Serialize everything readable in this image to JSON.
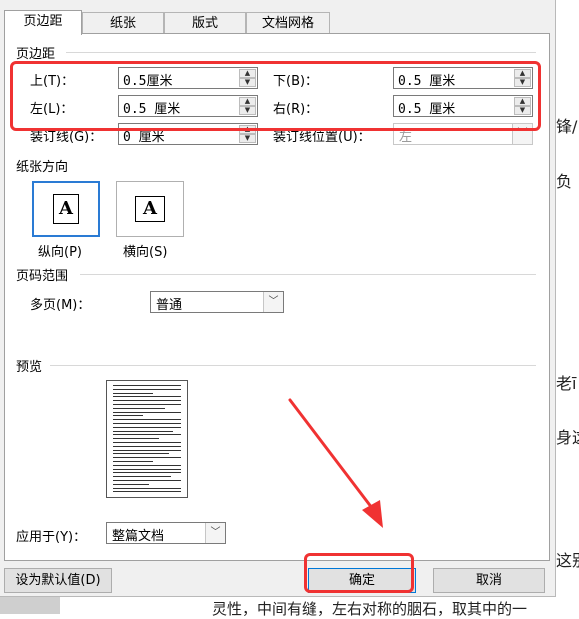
{
  "tabs": [
    "页边距",
    "纸张",
    "版式",
    "文档网格"
  ],
  "margins": {
    "title": "页边距",
    "top": {
      "label": "上(T)：",
      "value": "0.5厘米"
    },
    "bottom": {
      "label": "下(B)：",
      "value": "0.5 厘米"
    },
    "left": {
      "label": "左(L)：",
      "value": "0.5 厘米"
    },
    "right": {
      "label": "右(R)：",
      "value": "0.5 厘米"
    },
    "gutter": {
      "label": "装订线(G)：",
      "value": "0 厘米"
    },
    "gutter_pos": {
      "label": "装订线位置(U)：",
      "value": "左"
    }
  },
  "orientation": {
    "title": "纸张方向",
    "portrait": {
      "label": "纵向(P)",
      "glyph": "A"
    },
    "landscape": {
      "label": "横向(S)",
      "glyph": "A"
    }
  },
  "pages": {
    "title": "页码范围",
    "multi_label": "多页(M)：",
    "multi_value": "普通"
  },
  "preview": {
    "title": "预览"
  },
  "apply": {
    "label": "应用于(Y)：",
    "value": "整篇文档"
  },
  "buttons": {
    "default": "设为默认值(D)",
    "ok": "确定",
    "cancel": "取消"
  },
  "background_text": [
    "锋/",
    "负",
    "老ī",
    "身这",
    "这别",
    "灵性，中间有缝，左右对称的胭石，取其中的一"
  ],
  "colors": {
    "highlight": "#f03232",
    "accent": "#2a7bd4"
  },
  "icons": [
    "arrow-annotation",
    "spin-up-icon",
    "spin-down-icon",
    "chevron-down-icon"
  ]
}
